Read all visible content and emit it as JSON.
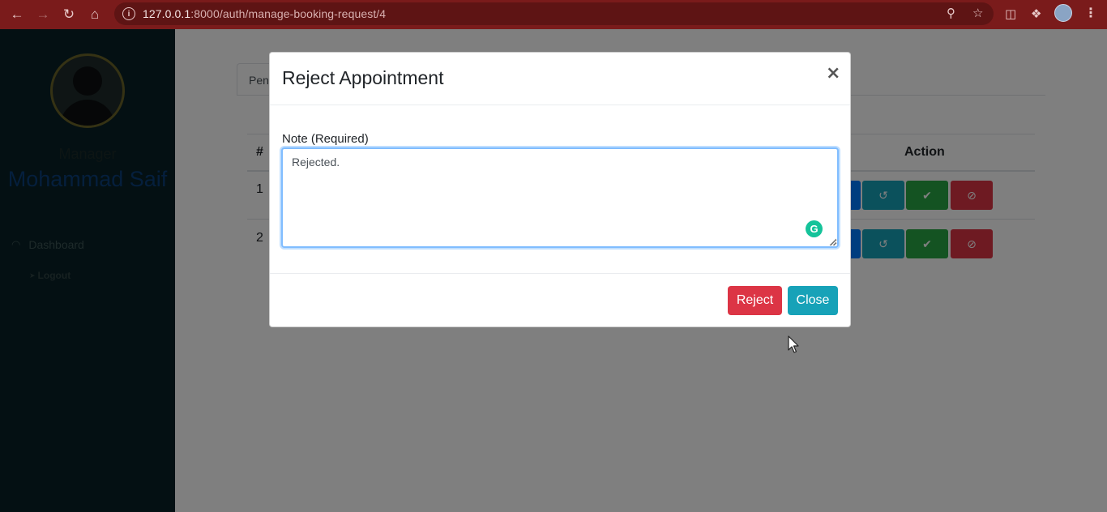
{
  "browser": {
    "url_host": "127.0.0.1",
    "url_path": ":8000/auth/manage-booking-request/4",
    "icons": [
      "back-icon",
      "forward-icon",
      "reload-icon",
      "home-icon",
      "info-icon",
      "zoom-icon",
      "star-icon",
      "reading-list-icon",
      "extensions-icon",
      "profile-avatar",
      "menu-icon"
    ]
  },
  "sidebar": {
    "role": "Manager",
    "name": "Mohammad Saif",
    "items": [
      {
        "label": "Dashboard",
        "icon": "tachometer-icon"
      },
      {
        "label": "Logout",
        "icon": "logout-icon"
      }
    ]
  },
  "main": {
    "tab_label": "Pen",
    "table": {
      "headers": [
        "#",
        "Action"
      ],
      "rows": [
        {
          "num": "1"
        },
        {
          "num": "2"
        }
      ]
    }
  },
  "modal": {
    "title": "Reject Appointment",
    "close_symbol": "×",
    "note_label": "Note (Required)",
    "note_value": "Rejected. ",
    "reject_label": "Reject",
    "close_label": "Close"
  },
  "colors": {
    "chrome": "#7a1b1b",
    "sidebar": "#082126",
    "primary": "#007bff",
    "info": "#17a2b8",
    "success": "#28a745",
    "danger": "#dc3545"
  }
}
